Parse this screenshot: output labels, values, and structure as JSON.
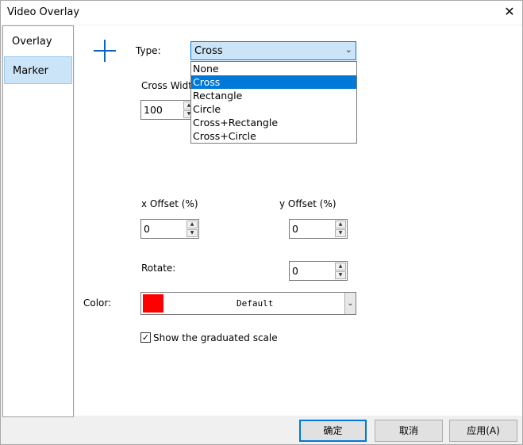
{
  "window": {
    "title": "Video Overlay",
    "close_glyph": "✕"
  },
  "nav": {
    "items": [
      {
        "label": "Overlay"
      },
      {
        "label": "Marker"
      }
    ]
  },
  "type_field": {
    "label": "Type:",
    "selected": "Cross",
    "options": [
      "None",
      "Cross",
      "Rectangle",
      "Circle",
      "Cross+Rectangle",
      "Cross+Circle"
    ]
  },
  "cross_width": {
    "label": "Cross Width",
    "value": "100"
  },
  "x_offset": {
    "label": "x Offset (%)",
    "value": "0"
  },
  "y_offset": {
    "label": "y Offset (%)",
    "value": "0"
  },
  "rotate": {
    "label": "Rotate:",
    "value": "0"
  },
  "color": {
    "label": "Color:",
    "swatch": "#ff0000",
    "name": "Default"
  },
  "scale_checkbox": {
    "label": "Show the graduated scale",
    "checked": true
  },
  "buttons": {
    "ok": "确定",
    "cancel": "取消",
    "apply": "应用(A)"
  }
}
